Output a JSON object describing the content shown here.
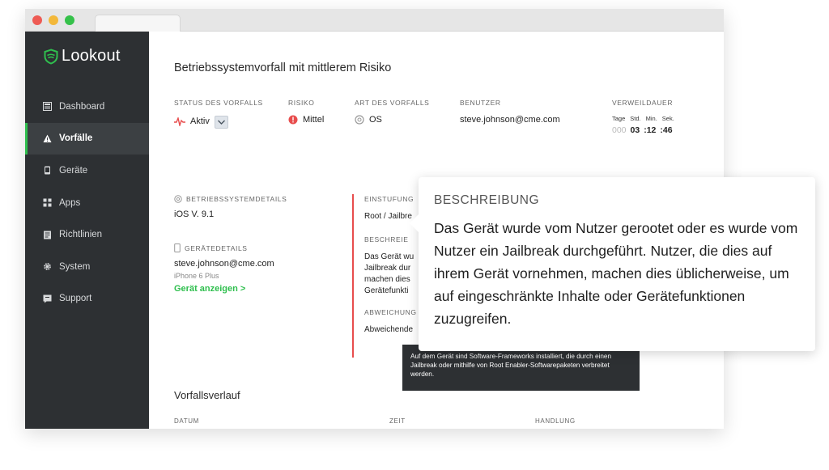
{
  "app": {
    "logo_text": "Lookout",
    "accent": "#2fbf4e",
    "sidebar_bg": "#2d3033"
  },
  "sidebar": {
    "items": [
      {
        "label": "Dashboard",
        "icon": "dashboard-icon",
        "active": false
      },
      {
        "label": "Vorfälle",
        "icon": "warning-icon",
        "active": true
      },
      {
        "label": "Geräte",
        "icon": "device-icon",
        "active": false
      },
      {
        "label": "Apps",
        "icon": "apps-grid-icon",
        "active": false
      },
      {
        "label": "Richtlinien",
        "icon": "policy-icon",
        "active": false
      },
      {
        "label": "System",
        "icon": "gear-icon",
        "active": false
      },
      {
        "label": "Support",
        "icon": "support-icon",
        "active": false
      }
    ]
  },
  "incident": {
    "title": "Betriebssystemvorfall mit mittlerem Risiko",
    "status": {
      "label": "STATUS DES VORFALLS",
      "value": "Aktiv"
    },
    "risk": {
      "label": "RISIKO",
      "value": "Mittel",
      "color": "#e84d4d"
    },
    "type": {
      "label": "ART DES VORFALLS",
      "value": "OS"
    },
    "user": {
      "label": "BENUTZER",
      "value": "steve.johnson@cme.com"
    },
    "dwell": {
      "label": "VERWEILDAUER",
      "units": [
        "Tage",
        "Std.",
        "Min.",
        "Sek."
      ],
      "days": "000",
      "hours": "03",
      "minutes": ":12",
      "seconds": ":46"
    }
  },
  "os_details": {
    "label": "BETRIEBSSYSTEMDETAILS",
    "value": "iOS V. 9.1"
  },
  "device_details": {
    "label": "GERÄTEDETAILS",
    "email": "steve.johnson@cme.com",
    "model": "iPhone 6 Plus",
    "link": "Gerät anzeigen >"
  },
  "classification": {
    "label": "EINSTUFUNG",
    "value": "Root / Jailbre",
    "desc_label": "BESCHREIE",
    "desc_lines": [
      "Das Gerät wu",
      "Jailbreak dur",
      "machen dies",
      "Gerätefunkti"
    ],
    "deviation_label": "ABWEICHUNG",
    "deviation_value": "Abweichende"
  },
  "tooltip": {
    "text": "Auf dem Gerät sind Software-Frameworks installiert, die durch einen Jailbreak oder mithilfe von Root Enabler-Softwarepaketen verbreitet werden."
  },
  "callout": {
    "title": "BESCHREIBUNG",
    "text": "Das Gerät wurde vom Nutzer gerootet oder es wurde vom Nutzer ein Jailbreak durchgeführt. Nutzer, die dies auf ihrem Gerät vornehmen, machen dies üblicherweise, um auf eingeschränkte Inhalte oder Gerätefunktionen zuzugreifen."
  },
  "history": {
    "title": "Vorfallsverlauf",
    "columns": [
      "DATUM",
      "ZEIT",
      "HANDLUNG"
    ]
  }
}
